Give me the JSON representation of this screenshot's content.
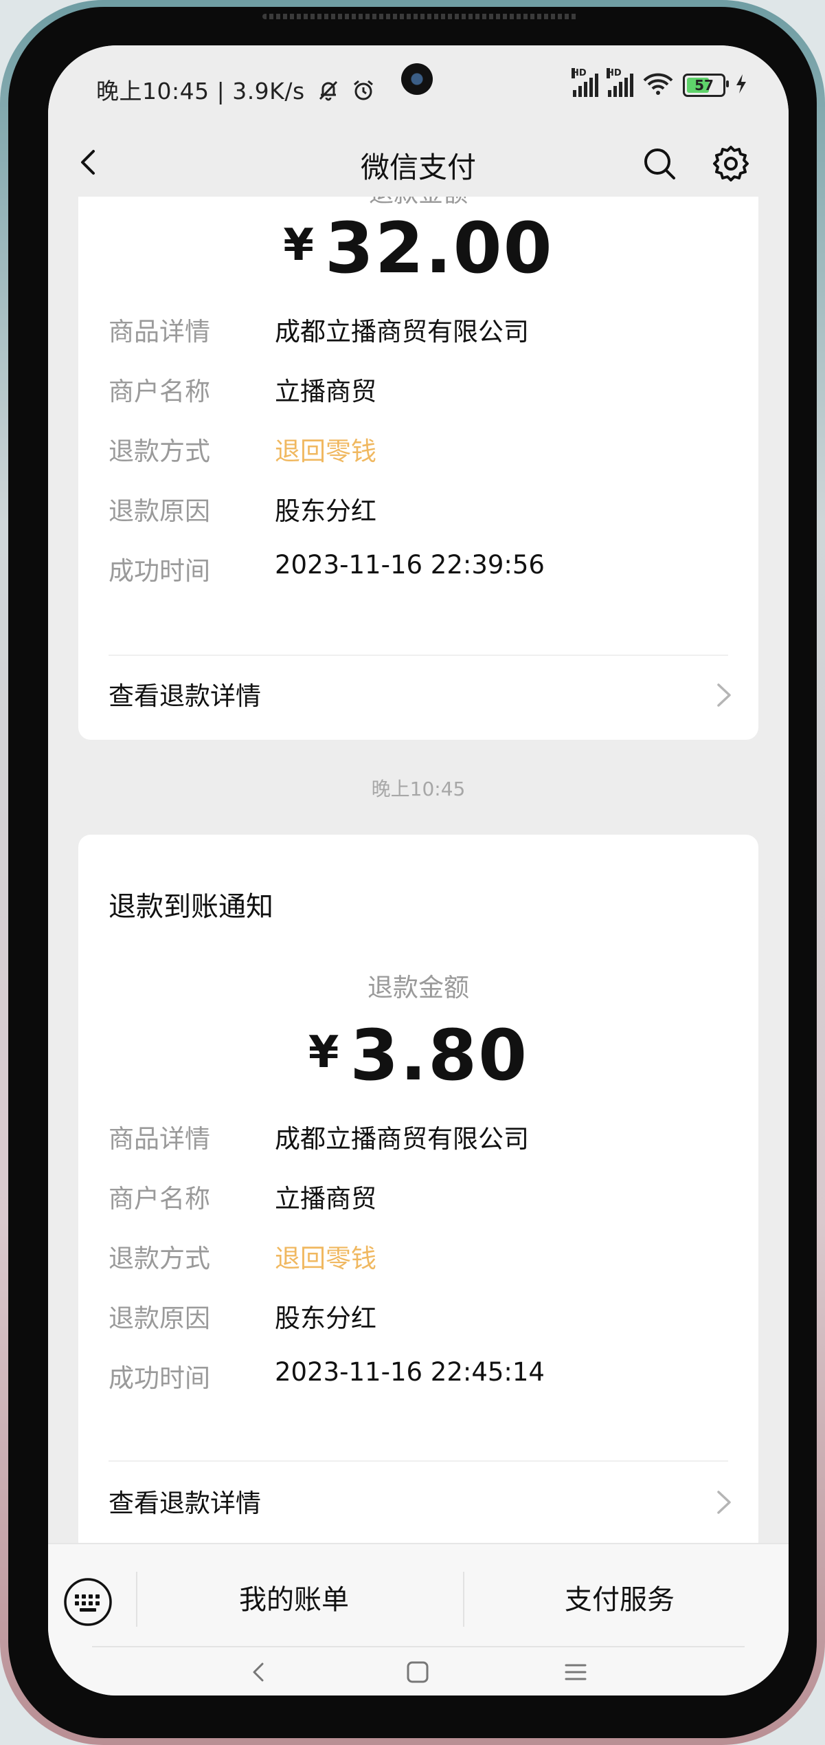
{
  "status_bar": {
    "time_speed": "晚上10:45 | 3.9K/s",
    "hd1": "HD",
    "hd2": "HD",
    "battery_level": "57"
  },
  "header": {
    "title": "微信支付"
  },
  "card1": {
    "partial_label": "退款金额",
    "currency": "¥",
    "amount": "32.00",
    "rows": [
      {
        "key": "商品详情",
        "value": "成都立播商贸有限公司"
      },
      {
        "key": "商户名称",
        "value": "立播商贸"
      },
      {
        "key": "退款方式",
        "value": "退回零钱"
      },
      {
        "key": "退款原因",
        "value": "股东分红"
      },
      {
        "key": "成功时间",
        "value": "2023-11-16 22:39:56"
      }
    ],
    "detail_link": "查看退款详情"
  },
  "timestamp": "晚上10:45",
  "card2": {
    "title": "退款到账通知",
    "amount_label": "退款金额",
    "currency": "¥",
    "amount": "3.80",
    "rows": [
      {
        "key": "商品详情",
        "value": "成都立播商贸有限公司"
      },
      {
        "key": "商户名称",
        "value": "立播商贸"
      },
      {
        "key": "退款方式",
        "value": "退回零钱"
      },
      {
        "key": "退款原因",
        "value": "股东分红"
      },
      {
        "key": "成功时间",
        "value": "2023-11-16 22:45:14"
      }
    ],
    "detail_link": "查看退款详情"
  },
  "bottom_bar": {
    "tab1": "我的账单",
    "tab2": "支付服务"
  },
  "colors": {
    "accent_orange": "#f0b860",
    "label_gray": "#9a9a9a",
    "battery_green": "#5fd36b"
  },
  "icons": [
    "back-arrow-icon",
    "search-icon",
    "gear-icon",
    "chevron-right-icon",
    "keyboard-icon",
    "nav-back-icon",
    "nav-home-icon",
    "nav-menu-icon",
    "mute-bell-icon",
    "alarm-icon",
    "wifi-icon",
    "charging-icon"
  ]
}
